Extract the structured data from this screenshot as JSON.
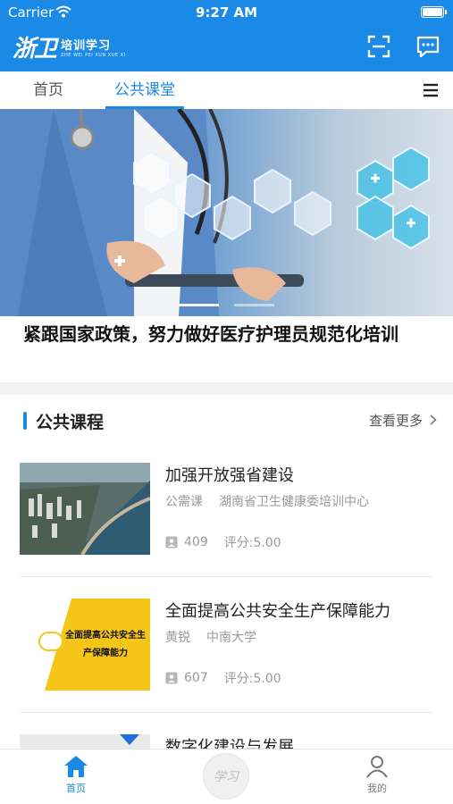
{
  "status_bar": {
    "carrier": "Carrier",
    "time": "9:27 AM"
  },
  "header": {
    "logo_mark": "浙卫",
    "logo_text": "培训学习",
    "logo_subtext": "ZHE WEI PEI XUN XUE XI",
    "colors": {
      "primary": "#1b8ae6"
    },
    "icons": [
      "scan-icon",
      "message-icon"
    ]
  },
  "tabs": [
    {
      "label": "首页",
      "active": false
    },
    {
      "label": "公共课堂",
      "active": true
    }
  ],
  "banner": {
    "caption": "紧跟国家政策，努力做好医疗护理员规范化培训"
  },
  "section": {
    "title": "公共课程",
    "more_label": "查看更多"
  },
  "courses": [
    {
      "title": "加强开放强省建设",
      "category": "公需课",
      "org": "湖南省卫生健康委培训中心",
      "learners": "409",
      "score": "评分:5.00",
      "thumb": "city-aerial"
    },
    {
      "title": "全面提高公共安全生产保障能力",
      "category": "黄锐",
      "org": "中南大学",
      "learners": "607",
      "score": "评分:5.00",
      "thumb_text": "全面提高公共安全生产保障能力"
    },
    {
      "title": "数字化建设与发展"
    }
  ],
  "tabbar": {
    "home": "首页",
    "center": "学习",
    "mine": "我的"
  }
}
